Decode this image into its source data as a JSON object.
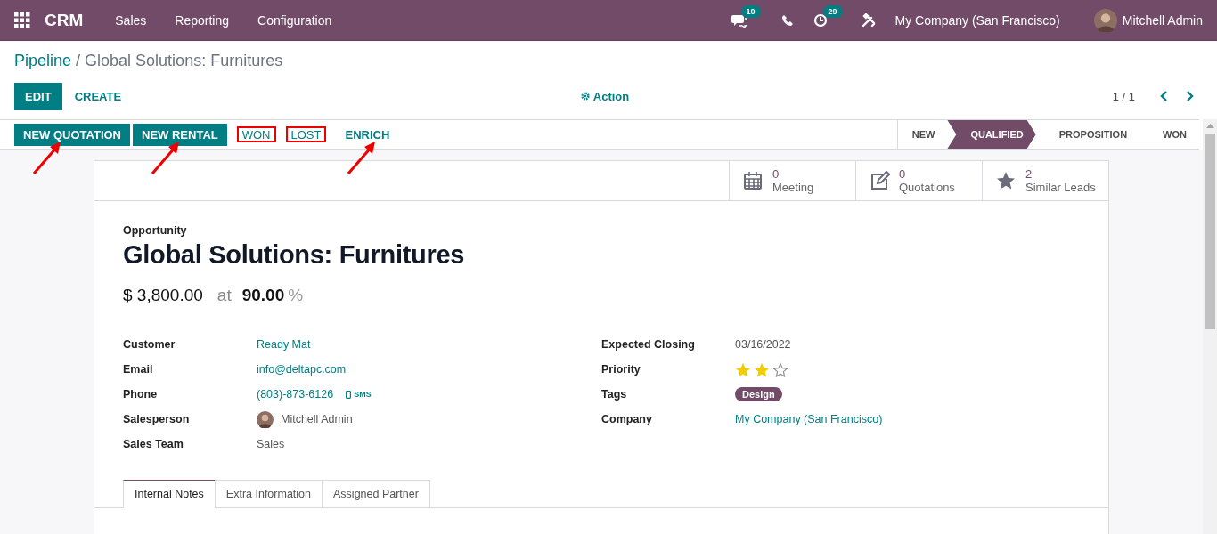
{
  "navbar": {
    "app": "CRM",
    "menus": [
      "Sales",
      "Reporting",
      "Configuration"
    ],
    "messages_badge": "10",
    "activities_badge": "29",
    "company": "My Company (San Francisco)",
    "user": "Mitchell Admin"
  },
  "breadcrumb": {
    "parent": "Pipeline",
    "separator": "/",
    "current": "Global Solutions: Furnitures"
  },
  "control_buttons": [
    {
      "label": "EDIT",
      "kind": "primary"
    },
    {
      "label": "CREATE",
      "kind": "secondary"
    }
  ],
  "action": "Action",
  "pager": "1 / 1",
  "header_buttons": [
    {
      "label": "NEW QUOTATION",
      "kind": "primary",
      "highlighted": false,
      "arrow": true
    },
    {
      "label": "NEW RENTAL",
      "kind": "primary",
      "highlighted": false,
      "arrow": true
    },
    {
      "label": "WON",
      "kind": "secondary",
      "highlighted": true,
      "arrow": false
    },
    {
      "label": "LOST",
      "kind": "secondary",
      "highlighted": true,
      "arrow": false
    },
    {
      "label": "ENRICH",
      "kind": "secondary",
      "highlighted": false,
      "arrow": true
    }
  ],
  "stages": [
    {
      "label": "NEW",
      "selected": false
    },
    {
      "label": "QUALIFIED",
      "selected": true
    },
    {
      "label": "PROPOSITION",
      "selected": false
    },
    {
      "label": "WON",
      "selected": false
    }
  ],
  "smart_buttons": [
    {
      "kind": "calendar",
      "count": "0",
      "label": "Meeting"
    },
    {
      "kind": "edit",
      "count": "0",
      "label": "Quotations"
    },
    {
      "kind": "star",
      "count": "2",
      "label": "Similar Leads"
    }
  ],
  "record": {
    "type_label": "Opportunity",
    "name": "Global Solutions: Furnitures",
    "revenue": "$ 3,800.00",
    "at": "at",
    "probability": "90.00",
    "percent": "%"
  },
  "left_fields": [
    {
      "label": "Customer",
      "kind": "link",
      "value": "Ready Mat"
    },
    {
      "label": "Email",
      "kind": "link",
      "value": "info@deltapc.com"
    },
    {
      "label": "Phone",
      "kind": "phone",
      "value": "(803)-873-6126",
      "action": "SMS"
    },
    {
      "label": "Salesperson",
      "kind": "user",
      "value": "Mitchell Admin"
    },
    {
      "label": "Sales Team",
      "kind": "text",
      "value": "Sales"
    }
  ],
  "right_fields": [
    {
      "label": "Expected Closing",
      "kind": "text",
      "value": "03/16/2022"
    },
    {
      "label": "Priority",
      "kind": "stars",
      "stars": 2
    },
    {
      "label": "Tags",
      "kind": "tags",
      "tags": [
        "Design"
      ]
    },
    {
      "label": "Company",
      "kind": "link",
      "value": "My Company (San Francisco)"
    }
  ],
  "notebook_tabs": [
    {
      "label": "Internal Notes",
      "selected": true
    },
    {
      "label": "Extra Information",
      "selected": false
    },
    {
      "label": "Assigned Partner",
      "selected": false
    }
  ]
}
